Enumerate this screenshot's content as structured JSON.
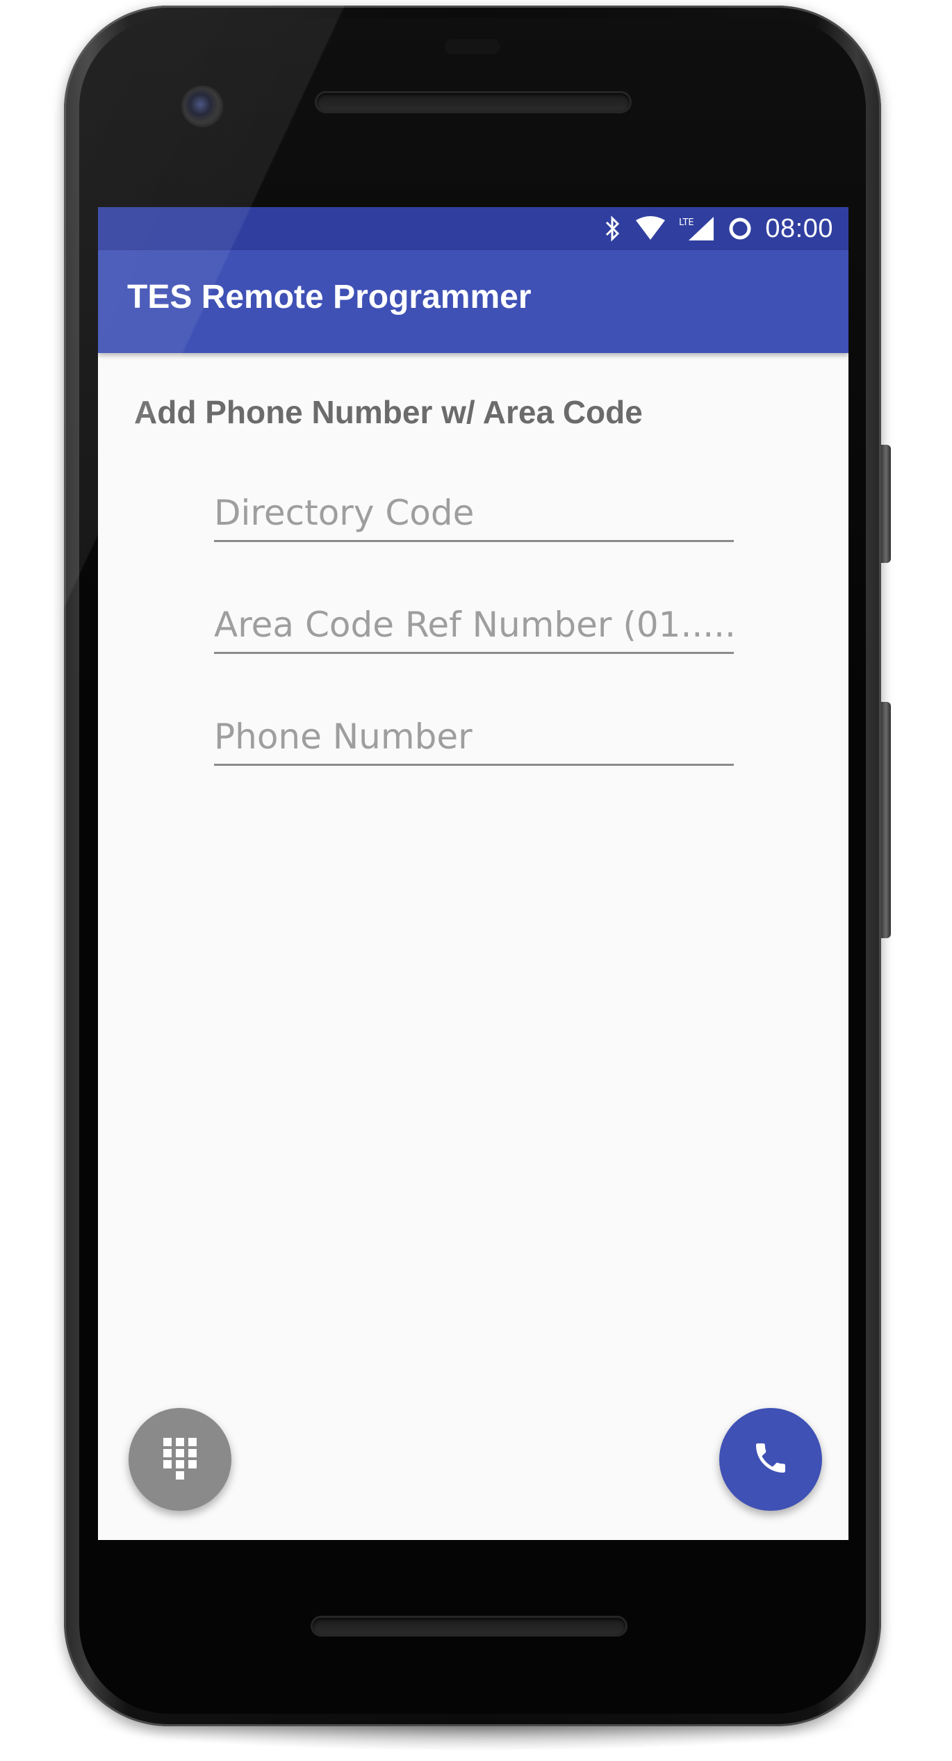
{
  "status_bar": {
    "time": "08:00",
    "network_label": "LTE",
    "icons": [
      "bluetooth-icon",
      "wifi-icon",
      "lte-signal-icon",
      "data-saver-icon"
    ]
  },
  "app_bar": {
    "title": "TES Remote Programmer"
  },
  "main": {
    "section_title": "Add Phone Number w/ Area Code",
    "fields": [
      {
        "name": "directory-code-field",
        "value": "",
        "placeholder": "Directory Code"
      },
      {
        "name": "area-code-ref-field",
        "value": "",
        "placeholder": "Area Code Ref Number (01....."
      },
      {
        "name": "phone-number-field",
        "value": "",
        "placeholder": "Phone Number"
      }
    ]
  },
  "fabs": {
    "dialpad": {
      "icon": "dialpad-icon"
    },
    "call": {
      "icon": "phone-icon"
    }
  },
  "colors": {
    "status_bar": "#303f9f",
    "app_bar": "#3f51b5",
    "screen_bg": "#fafafa",
    "fab_dialpad": "#8a8a8a",
    "fab_call": "#3f51b5"
  }
}
